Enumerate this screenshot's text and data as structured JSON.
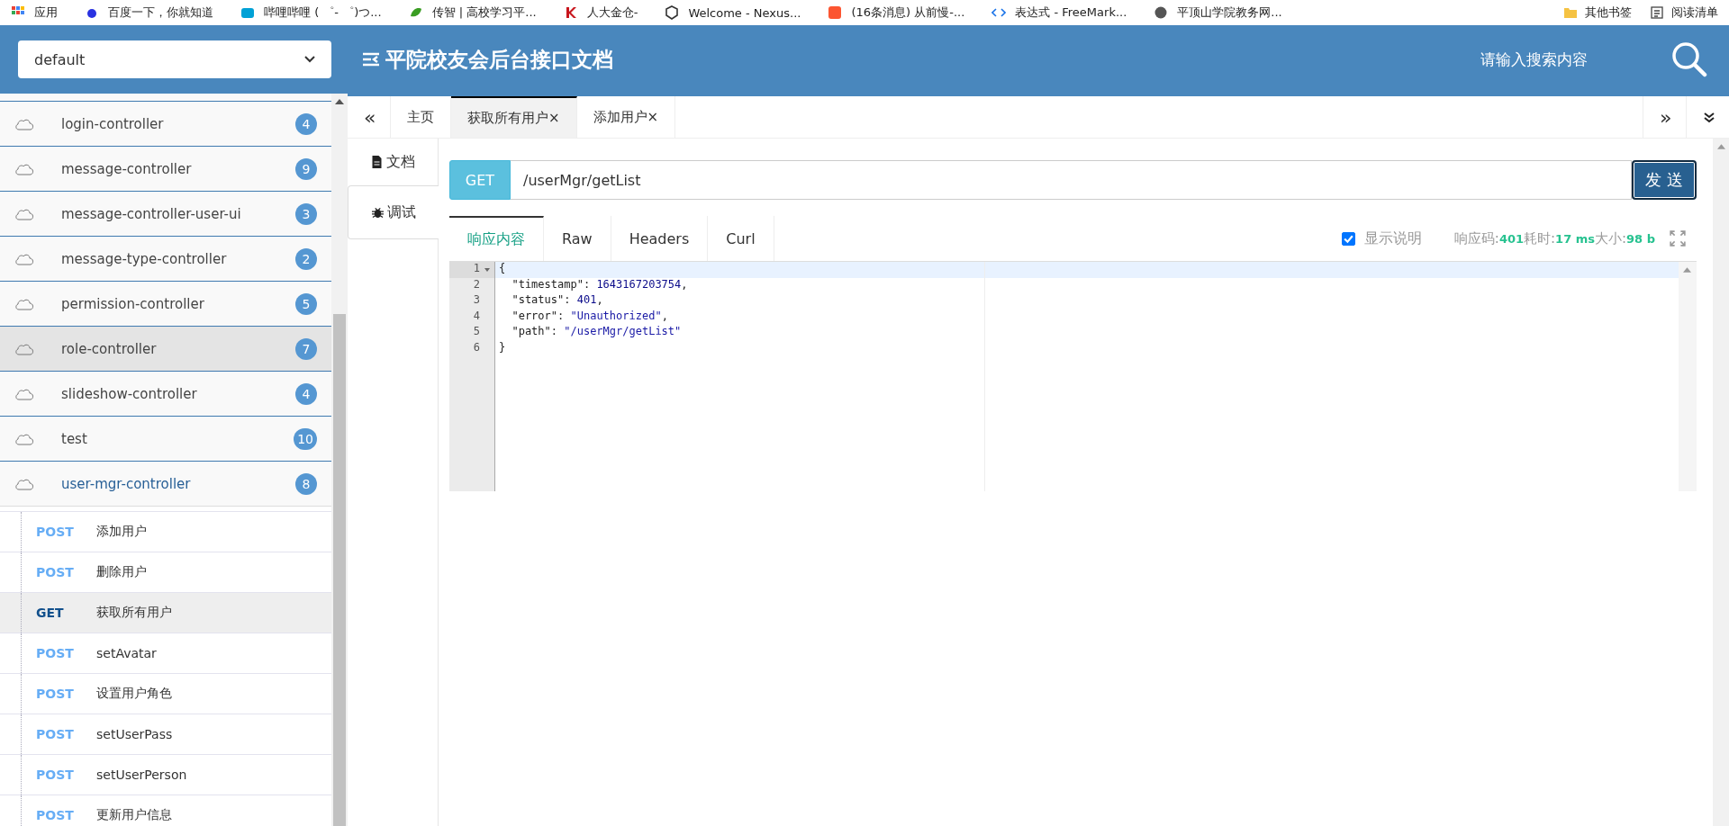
{
  "bookmarks": [
    {
      "label": "应用",
      "kind": "apps"
    },
    {
      "label": "百度一下，你就知道",
      "kind": "paw"
    },
    {
      "label": "哔哩哔哩 ( ゜- ゜)つ...",
      "kind": "tv"
    },
    {
      "label": "传智 | 高校学习平...",
      "kind": "leaf"
    },
    {
      "label": "人大金仓-",
      "kind": "k"
    },
    {
      "label": "Welcome - Nexus...",
      "kind": "shield"
    },
    {
      "label": "(16条消息) 从前慢-...",
      "kind": "c"
    },
    {
      "label": "表达式 - FreeMark...",
      "kind": "code"
    },
    {
      "label": "平顶山学院教务网...",
      "kind": "globe"
    }
  ],
  "bookmark_extras": [
    {
      "label": "其他书签",
      "kind": "folder"
    },
    {
      "label": "阅读清单",
      "kind": "list"
    }
  ],
  "header": {
    "group_select": "default",
    "title": "平院校友会后台接口文档",
    "search_placeholder": "请输入搜索内容"
  },
  "sidebar": {
    "groups": [
      {
        "name": "login-controller",
        "count": "4",
        "selected": false,
        "expanded": false
      },
      {
        "name": "message-controller",
        "count": "9",
        "selected": false,
        "expanded": false
      },
      {
        "name": "message-controller-user-ui",
        "count": "3",
        "selected": false,
        "expanded": false
      },
      {
        "name": "message-type-controller",
        "count": "2",
        "selected": false,
        "expanded": false
      },
      {
        "name": "permission-controller",
        "count": "5",
        "selected": false,
        "expanded": false
      },
      {
        "name": "role-controller",
        "count": "7",
        "selected": true,
        "expanded": false
      },
      {
        "name": "slideshow-controller",
        "count": "4",
        "selected": false,
        "expanded": false
      },
      {
        "name": "test",
        "count": "10",
        "selected": false,
        "expanded": false
      },
      {
        "name": "user-mgr-controller",
        "count": "8",
        "selected": false,
        "expanded": true,
        "children": [
          {
            "method": "POST",
            "name": "添加用户",
            "selected": false
          },
          {
            "method": "POST",
            "name": "删除用户",
            "selected": false
          },
          {
            "method": "GET",
            "name": "获取所有用户",
            "selected": true
          },
          {
            "method": "POST",
            "name": "setAvatar",
            "selected": false
          },
          {
            "method": "POST",
            "name": "设置用户角色",
            "selected": false
          },
          {
            "method": "POST",
            "name": "setUserPass",
            "selected": false
          },
          {
            "method": "POST",
            "name": "setUserPerson",
            "selected": false
          },
          {
            "method": "POST",
            "name": "更新用户信息",
            "selected": false
          }
        ]
      }
    ]
  },
  "tabs": {
    "prev": "«",
    "next": "»",
    "items": [
      {
        "label": "主页",
        "selected": false
      },
      {
        "label": "获取所有用户",
        "close": "×",
        "selected": true
      },
      {
        "label": "添加用户",
        "close": "×",
        "selected": false
      }
    ]
  },
  "side_tabs": [
    {
      "label": "文档",
      "kind": "doc",
      "selected": false
    },
    {
      "label": "调试",
      "kind": "bug",
      "selected": true
    }
  ],
  "request": {
    "method": "GET",
    "url": "/userMgr/getList",
    "send": "发 送"
  },
  "response_tabs": [
    {
      "label": "响应内容",
      "selected": true
    },
    {
      "label": "Raw",
      "selected": false
    },
    {
      "label": "Headers",
      "selected": false
    },
    {
      "label": "Curl",
      "selected": false
    }
  ],
  "show_description": {
    "label": "显示说明",
    "checked": true
  },
  "response_meta": [
    {
      "label": "响应码:",
      "value": "401"
    },
    {
      "label": "耗时:",
      "value": "17 ms"
    },
    {
      "label": "大小:",
      "value": "98 b"
    }
  ],
  "code_lines": [
    {
      "number": "1",
      "tokens": [
        {
          "kind": "punct",
          "text": "{"
        }
      ]
    },
    {
      "number": "2",
      "tokens": [
        {
          "kind": "key",
          "text": "  \"timestamp\""
        },
        {
          "kind": "punct",
          "text": ": "
        },
        {
          "kind": "number",
          "text": "1643167203754"
        },
        {
          "kind": "punct",
          "text": ","
        }
      ]
    },
    {
      "number": "3",
      "tokens": [
        {
          "kind": "key",
          "text": "  \"status\""
        },
        {
          "kind": "punct",
          "text": ": "
        },
        {
          "kind": "number",
          "text": "401"
        },
        {
          "kind": "punct",
          "text": ","
        }
      ]
    },
    {
      "number": "4",
      "tokens": [
        {
          "kind": "key",
          "text": "  \"error\""
        },
        {
          "kind": "punct",
          "text": ": "
        },
        {
          "kind": "string",
          "text": "\"Unauthorized\""
        },
        {
          "kind": "punct",
          "text": ","
        }
      ]
    },
    {
      "number": "5",
      "tokens": [
        {
          "kind": "key",
          "text": "  \"path\""
        },
        {
          "kind": "punct",
          "text": ": "
        },
        {
          "kind": "string",
          "text": "\"/userMgr/getList\""
        }
      ]
    },
    {
      "number": "6",
      "tokens": [
        {
          "kind": "punct",
          "text": "}"
        }
      ]
    }
  ]
}
